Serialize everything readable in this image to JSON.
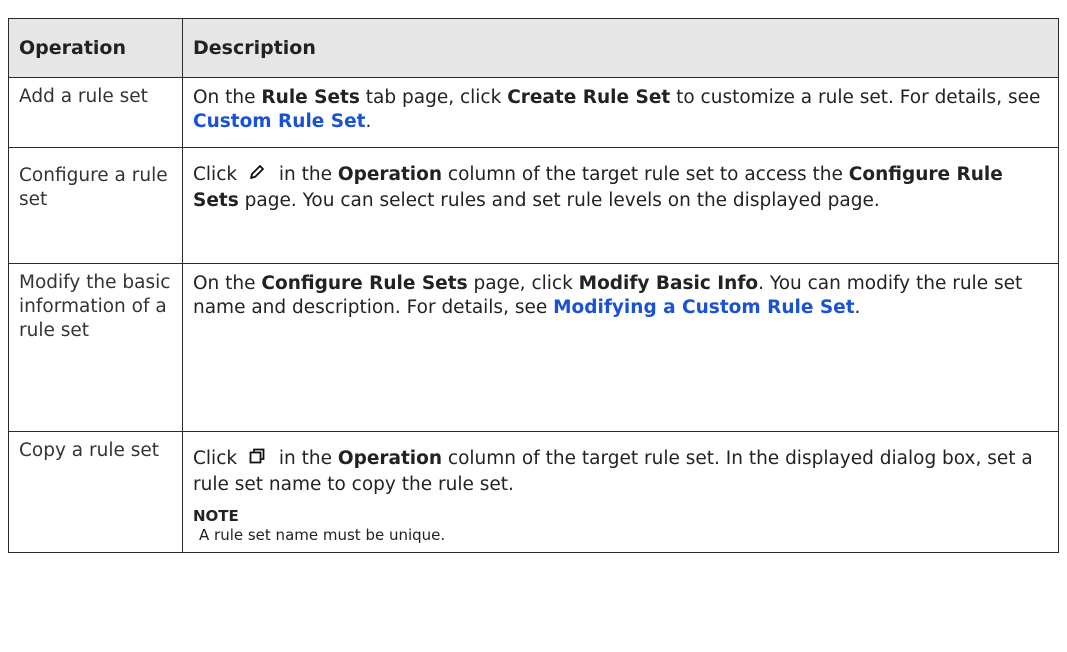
{
  "table": {
    "headers": [
      "Operation",
      "Description"
    ],
    "rows": [
      {
        "operation": "Add a rule set",
        "description": {
          "t1": "On the ",
          "b1": "Rule Sets",
          "t2": " tab page, click ",
          "b2": "Create Rule Set",
          "t3": " to customize a rule set. For details, see ",
          "link": "Custom Rule Set",
          "t4": "."
        }
      },
      {
        "operation": "Configure a rule set",
        "description": {
          "t1": "Click ",
          "icon": "pencil-icon",
          "t2": " in the ",
          "b1": "Operation",
          "t3": " column of the target rule set to access the ",
          "b2": "Configure Rule Sets",
          "t4": " page. You can select rules and set rule levels on the displayed page."
        }
      },
      {
        "operation": "Modify the basic information of a rule set",
        "description": {
          "t1": "On the ",
          "b1": "Configure Rule Sets",
          "t2": " page, click ",
          "b2": "Modify Basic Info",
          "t3": ". You can modify the rule set name and description. For details, see ",
          "link": "Modifying a Custom Rule Set",
          "t4": "."
        }
      },
      {
        "operation": "Copy a rule set",
        "description": {
          "t1": "Click ",
          "icon": "copy-icon",
          "t2": " in the ",
          "b1": "Operation",
          "t3": " column of the target rule set. In the displayed dialog box, set a rule set name to copy the rule set.",
          "note_label": "NOTE",
          "note_text": "A rule set name must be unique."
        }
      }
    ]
  },
  "colors": {
    "header_bg": "#e6e6e6",
    "border": "#2a2a2a",
    "link": "#1a52d4",
    "text": "#222222"
  }
}
